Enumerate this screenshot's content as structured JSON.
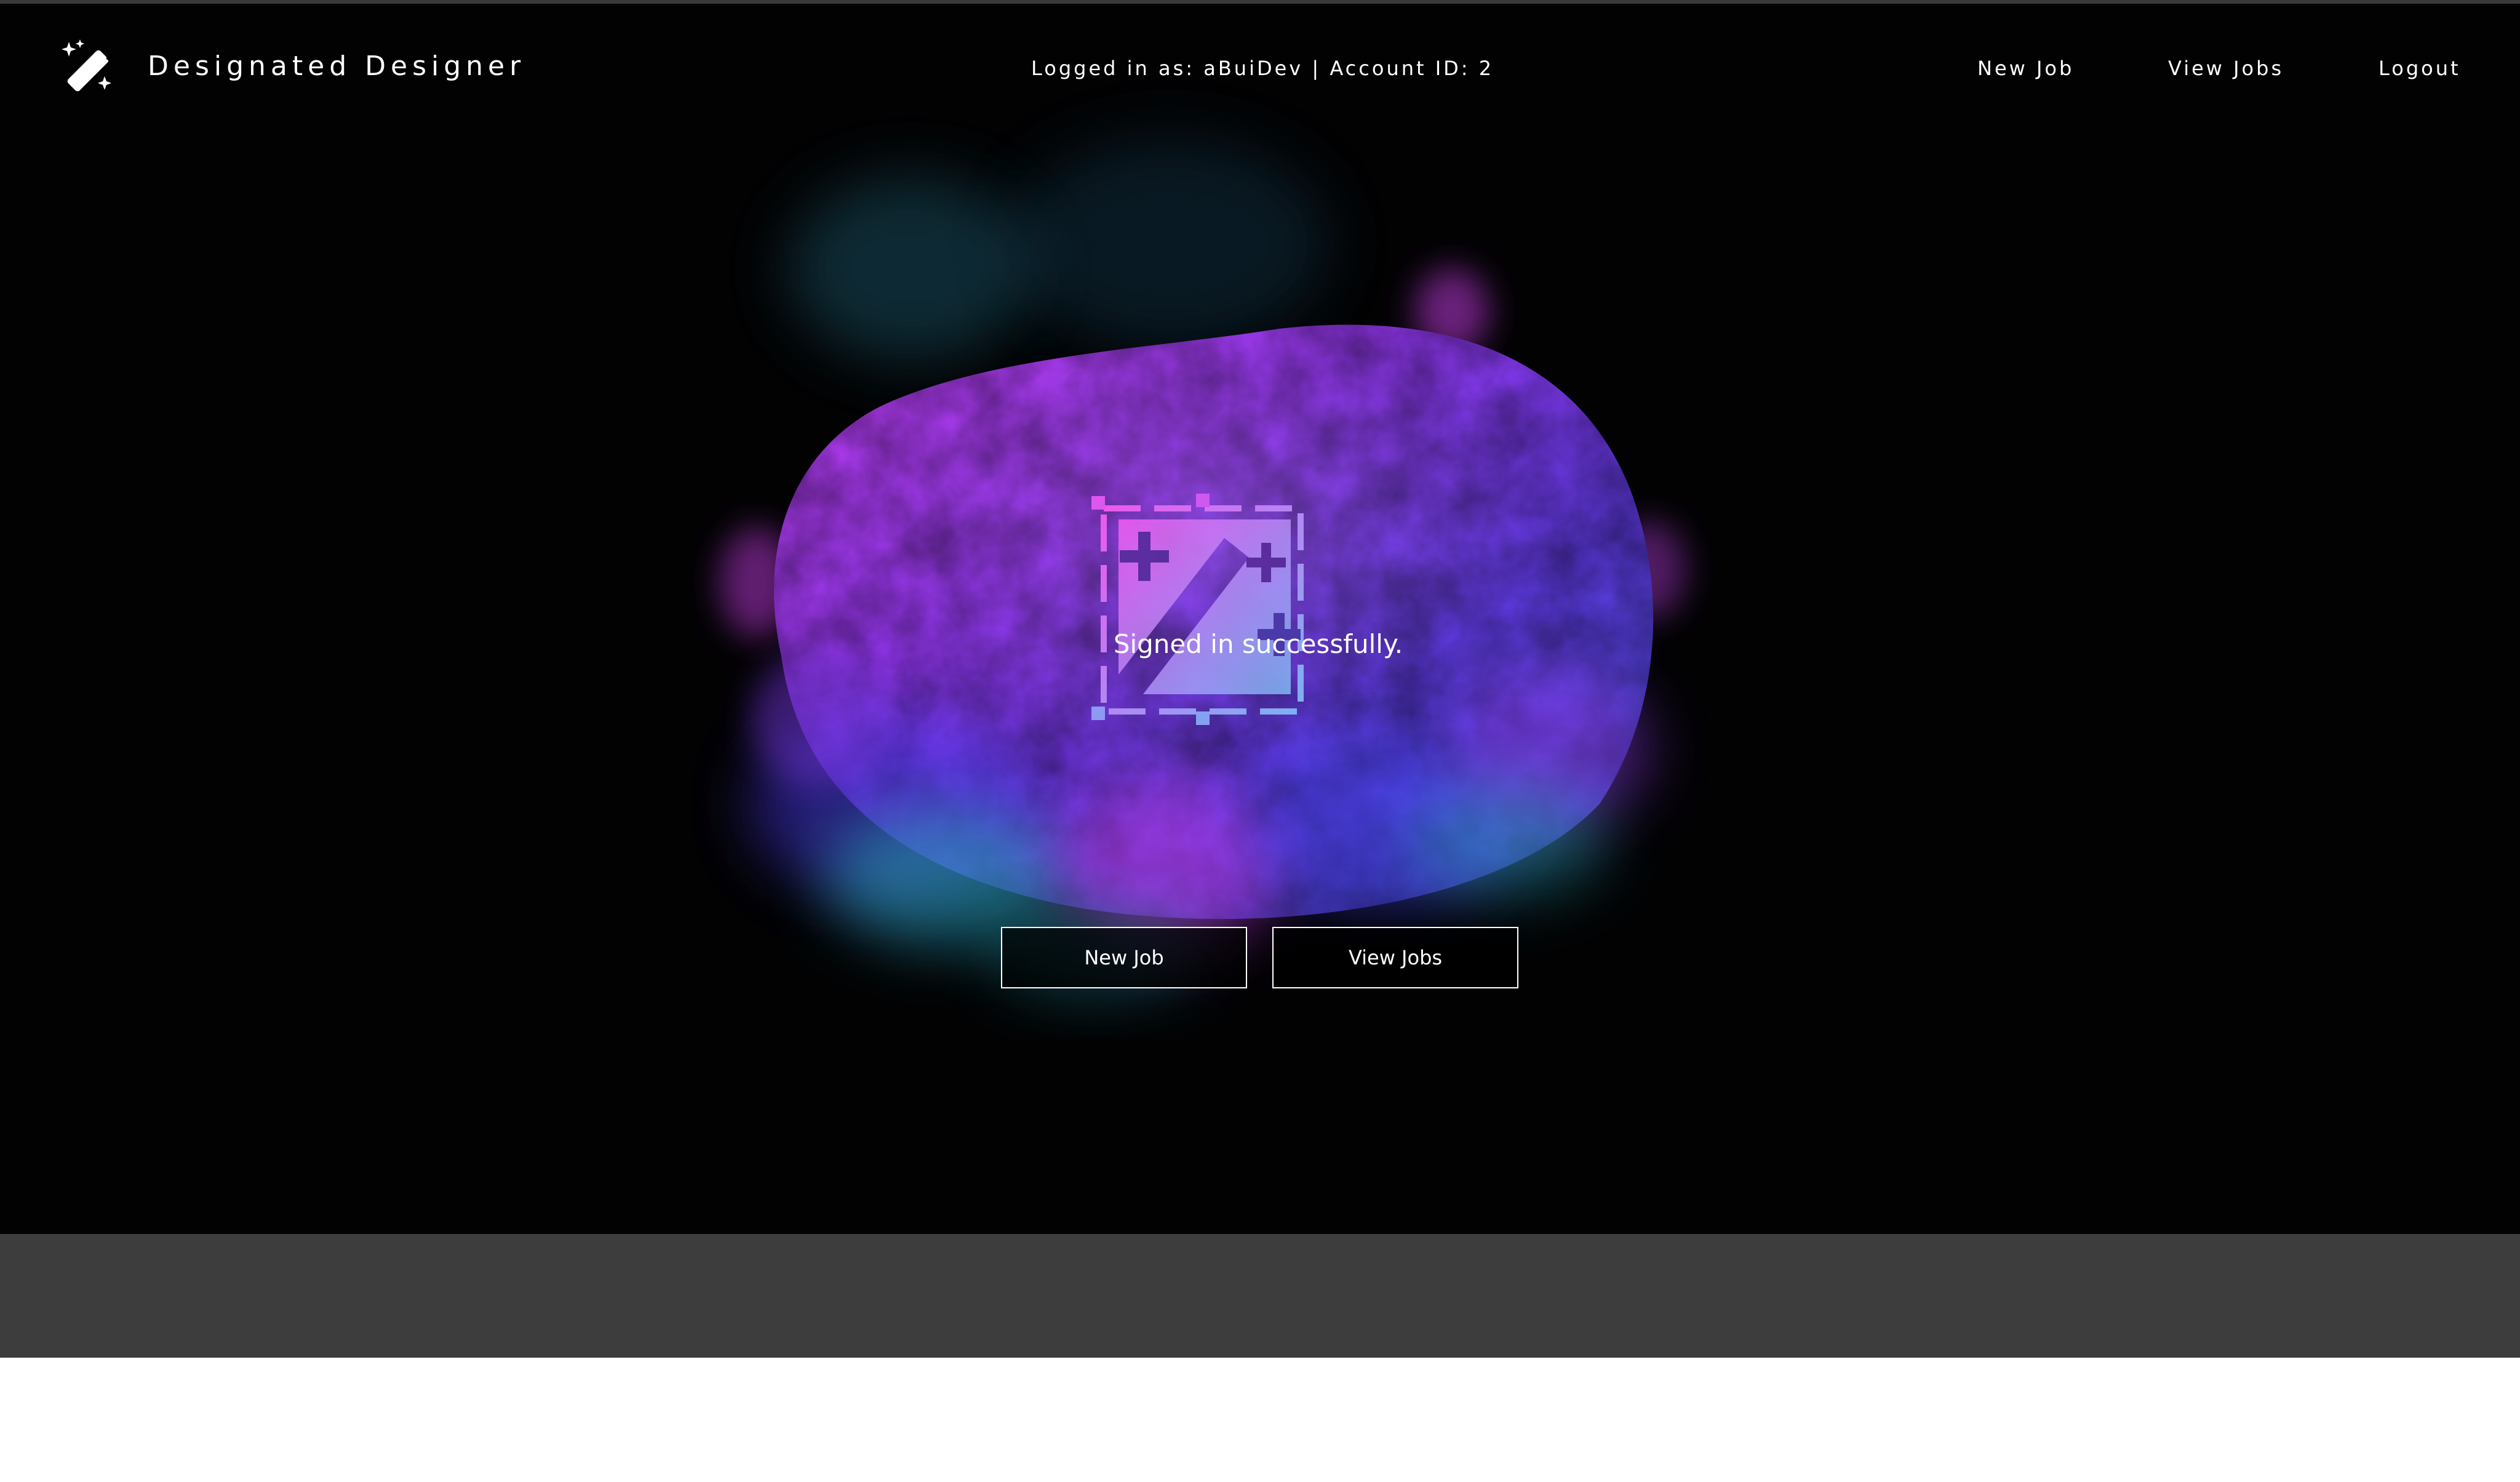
{
  "header": {
    "brand": "Designated Designer",
    "user_info": "Logged in as: aBuiDev | Account ID: 2",
    "nav": {
      "new_job": "New Job",
      "view_jobs": "View Jobs",
      "logout": "Logout"
    }
  },
  "main": {
    "flash_message": "Signed in successfully.",
    "buttons": {
      "new_job": "New Job",
      "view_jobs": "View Jobs"
    }
  },
  "icons": {
    "logo": "magic-wand-icon",
    "hero_graphic": "potato-smoke-illustration",
    "center_mark": "design-frame-icon"
  },
  "colors": {
    "background": "#020203",
    "footer_band": "#3d3d3d",
    "accent_magenta": "#c93cf0",
    "accent_violet": "#6e35f5",
    "accent_teal": "#2fb8c9",
    "text": "#ffffff"
  }
}
